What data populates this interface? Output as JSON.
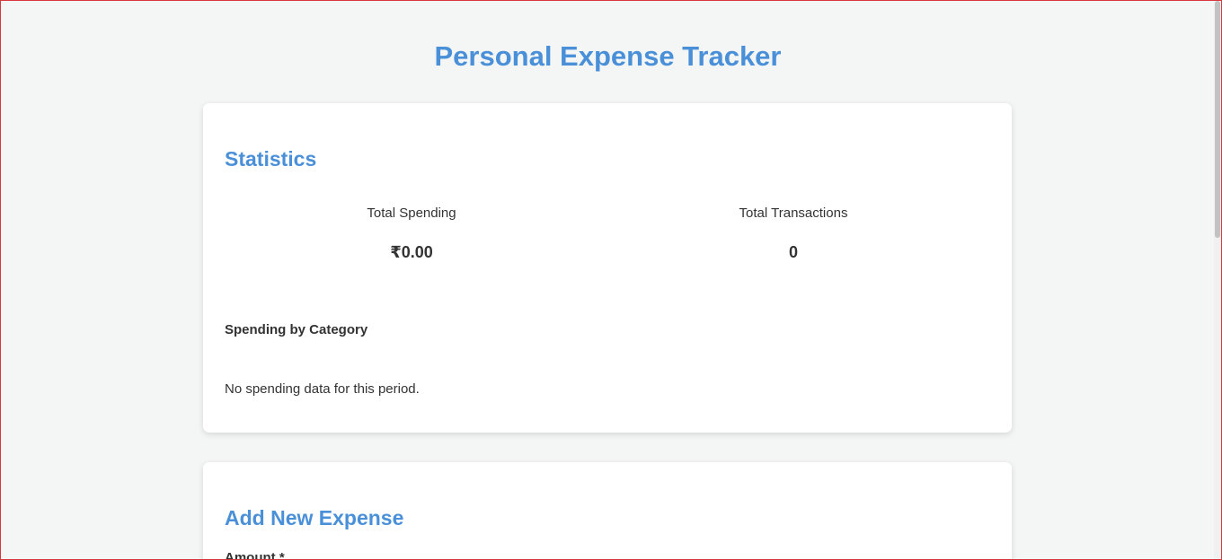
{
  "app": {
    "title": "Personal Expense Tracker"
  },
  "statistics": {
    "title": "Statistics",
    "total_spending_label": "Total Spending",
    "total_spending_value": "₹0.00",
    "total_transactions_label": "Total Transactions",
    "total_transactions_value": "0",
    "category_title": "Spending by Category",
    "empty_message": "No spending data for this period."
  },
  "add_expense": {
    "title": "Add New Expense",
    "amount_label": "Amount *"
  },
  "colors": {
    "accent": "#4a90d9",
    "background": "#f4f5f5",
    "card": "#ffffff",
    "text": "#333333"
  }
}
